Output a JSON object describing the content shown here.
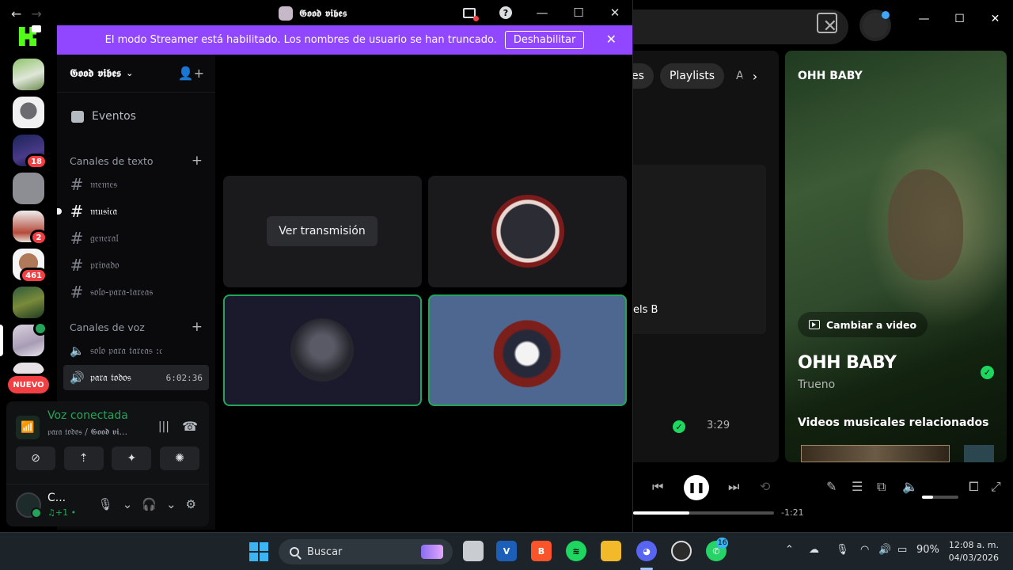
{
  "discord": {
    "window_title": "𝕲𝖔𝖔𝖉 𝖛𝖎𝖇𝖊𝖘",
    "banner": {
      "text": "El modo Streamer está habilitado. Los nombres de usuario se han truncado.",
      "button": "Deshabilitar"
    },
    "rail": {
      "badges": [
        "18",
        "2",
        "461"
      ],
      "new_label": "NUEVO"
    },
    "guild": {
      "name": "𝕲𝖔𝖔𝖉 𝖛𝖎𝖇𝖊𝖘",
      "events_label": "Eventos",
      "text_category": "Canales de texto",
      "text_channels": [
        "𝔪𝔢𝔪𝔢𝔰",
        "𝔪𝔲𝔰𝔦𝔠𝔞",
        "𝔤𝔢𝔫𝔢𝔯𝔞𝔩",
        "𝔭𝔯𝔦𝔳𝔞𝔡𝔬",
        "𝔰𝔬𝔩𝔬-𝔭𝔞𝔯𝔞-𝔱𝔞𝔯𝔢𝔞𝔰"
      ],
      "voice_category": "Canales de voz",
      "voice_channels": [
        {
          "name": "𝔰𝔬𝔩𝔬 𝔭𝔞𝔯𝔞 𝔱𝔞𝔯𝔢𝔞𝔰 :𝔠",
          "timer": ""
        },
        {
          "name": "𝔭𝔞𝔯𝔞 𝔱𝔬𝔡𝔬𝔰",
          "timer": "6:02:36"
        }
      ]
    },
    "voice_panel": {
      "status": "Voz conectada",
      "location": "𝔭𝔞𝔯𝔞 𝔱𝔬𝔡𝔬𝔰 / 𝕲𝖔𝖔𝖉 𝖛𝖎..."
    },
    "user": {
      "name": "C...",
      "status": "♫+1 •"
    },
    "stage": {
      "view_stream_label": "Ver transmisión"
    }
  },
  "spotify": {
    "chips": [
      "es",
      "Playlists",
      "A"
    ],
    "card_label": "els B",
    "row_duration": "3:29",
    "now_playing_header": "OHH BABY",
    "switch_video_label": "Cambiar a video",
    "track_title": "OHH BABY",
    "track_artist": "Trueno",
    "related_heading": "Videos musicales relacionados",
    "time_remaining": "-1:21",
    "progress_fraction": 0.4,
    "volume_fraction": 0.3
  },
  "taskbar": {
    "search_label": "Buscar",
    "discord_badge": "",
    "whatsapp_badge": "16",
    "battery": "90%",
    "time": "12:08 a. m.",
    "date": "04/03/2026"
  },
  "colors": {
    "streamer_banner": "#9146ff",
    "discord_green": "#23a559",
    "spotify_green": "#1ed760",
    "discord_red": "#f23f43"
  }
}
